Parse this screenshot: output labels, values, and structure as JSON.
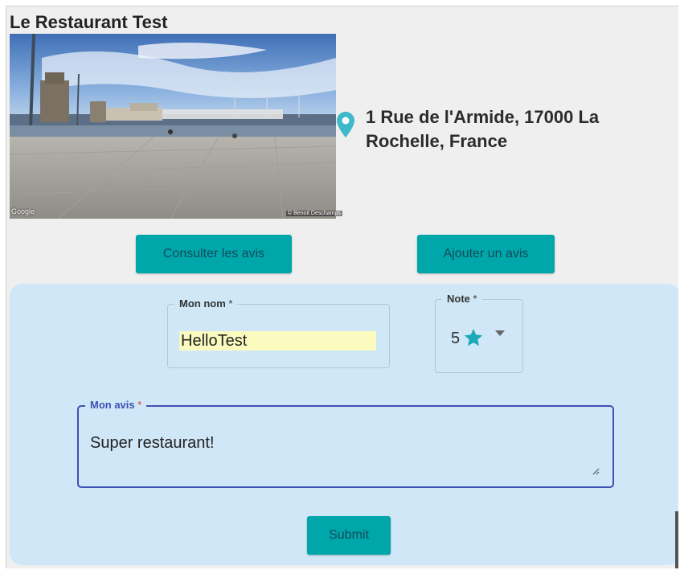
{
  "restaurant": {
    "name": "Le Restaurant Test",
    "address": "1 Rue de l'Armide, 17000 La Rochelle, France",
    "photo": {
      "google_label": "Google",
      "credit": "© Benoit Deschamps"
    }
  },
  "actions": {
    "consult_label": "Consulter les avis",
    "add_label": "Ajouter un avis"
  },
  "form": {
    "name_label": "Mon nom",
    "name_value": "HelloTest",
    "note_label": "Note",
    "note_value": "5",
    "required_mark": "*",
    "review_label": "Mon avis",
    "review_value": "Super restaurant!",
    "submit_label": "Submit"
  },
  "icons": {
    "pin": "map-pin-icon",
    "star": "star-icon",
    "caret": "caret-down-icon",
    "resize": "resize-handle-icon"
  },
  "colors": {
    "accent": "#00a7aa",
    "panel": "#cfe7f6",
    "focus": "#3f51b5",
    "required": "#e53935",
    "autofill": "#fbfbc0",
    "pin": "#3fb8c9",
    "star": "#1aa9b9"
  }
}
